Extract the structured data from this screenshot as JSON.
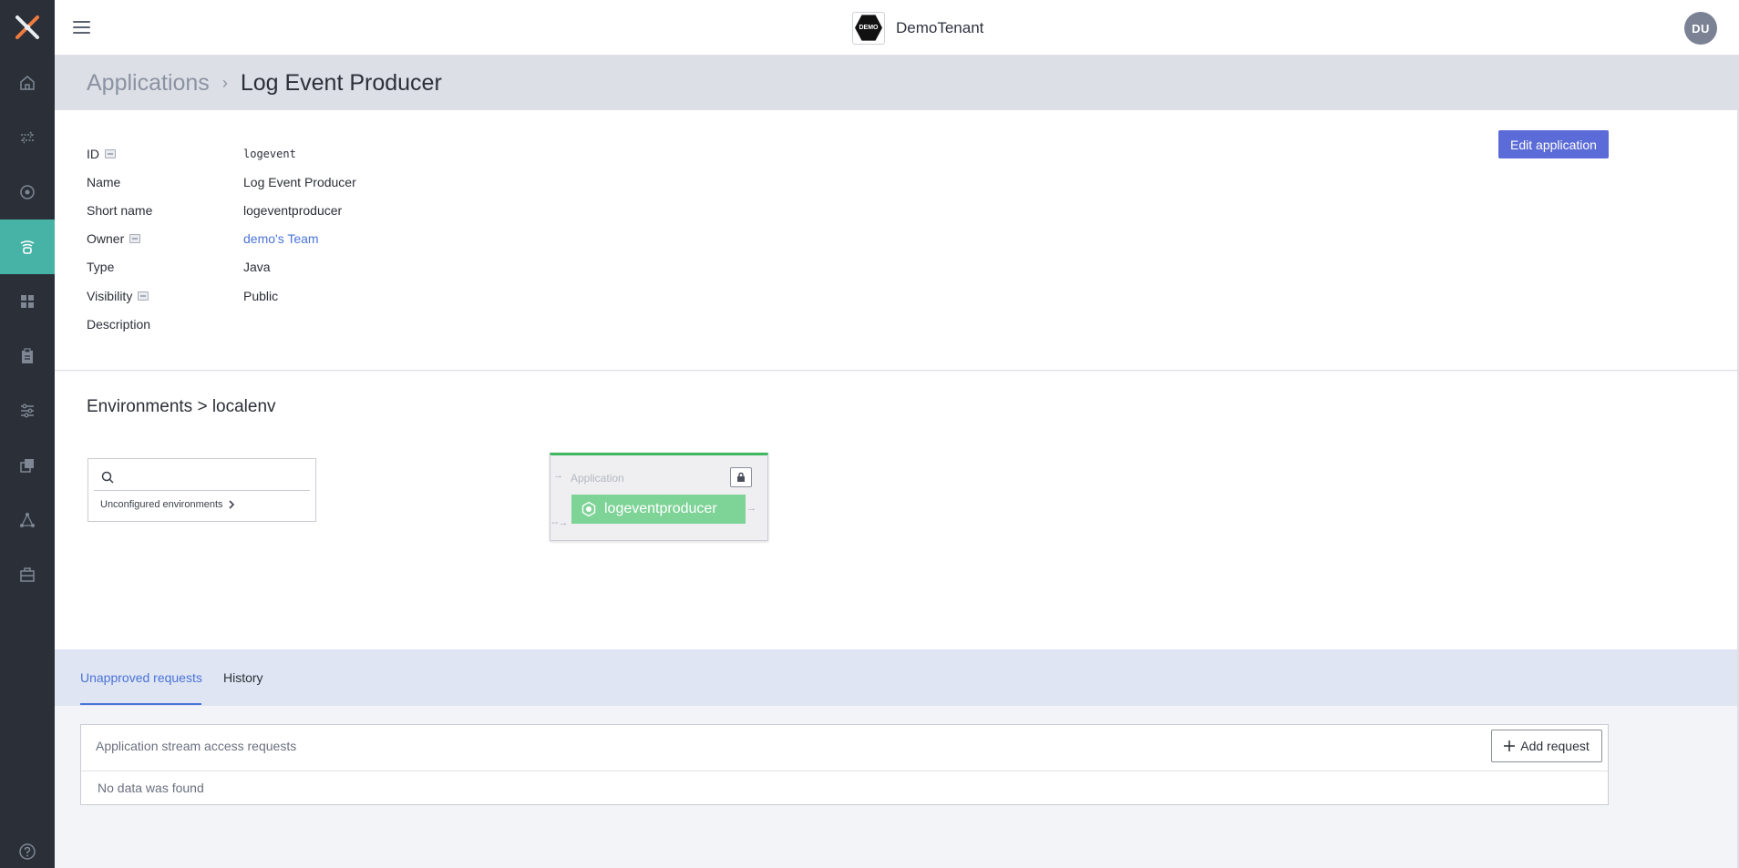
{
  "topbar": {
    "tenant_name": "DemoTenant",
    "tenant_logo_text": "DEMO",
    "avatar_initials": "DU"
  },
  "breadcrumb": {
    "parent": "Applications",
    "separator": "›",
    "current": "Log Event Producer"
  },
  "details": {
    "edit_button": "Edit application",
    "rows": [
      {
        "label": "ID",
        "value": "logevent"
      },
      {
        "label": "Name",
        "value": "Log Event Producer"
      },
      {
        "label": "Short name",
        "value": "logeventproducer"
      },
      {
        "label": "Owner",
        "value": "demo's Team"
      },
      {
        "label": "Type",
        "value": "Java"
      },
      {
        "label": "Visibility",
        "value": "Public"
      },
      {
        "label": "Description",
        "value": ""
      }
    ]
  },
  "environments": {
    "title": "Environments > localenv",
    "search_placeholder": "",
    "unconfigured_label": "Unconfigured environments",
    "node": {
      "type_label": "Application",
      "name": "logeventproducer"
    }
  },
  "tabs": [
    {
      "label": "Unapproved requests",
      "active": true
    },
    {
      "label": "History",
      "active": false
    }
  ],
  "requests": {
    "title": "Application stream access requests",
    "add_button": "Add request",
    "empty_text": "No data was found"
  },
  "colors": {
    "accent": "#5b6bd7",
    "nav_active": "#46b3a6",
    "node_green": "#7ed397",
    "link": "#4a73d9"
  }
}
